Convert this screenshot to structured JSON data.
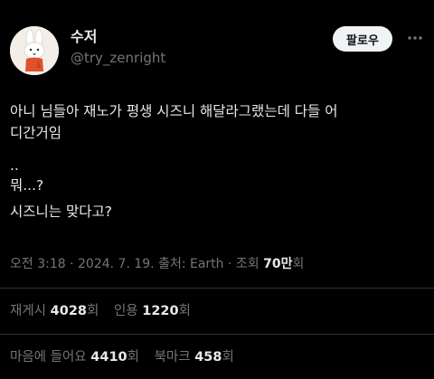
{
  "author": {
    "display_name": "수저",
    "handle": "@try_zenright"
  },
  "follow_button_label": "팔로우",
  "tweet": {
    "lines": [
      "아니 님들아 재노가 평생 시즈니 해달라그랬는데 다들 어",
      "디간거임",
      "..",
      "뭐...?",
      "시즈니는 맞다고?"
    ]
  },
  "meta": {
    "time": "오전 3:18",
    "date": "2024. 7. 19.",
    "source_label": "출처: Earth",
    "views_label": "조회",
    "views_value": "70만",
    "views_unit": "회",
    "separator": "·"
  },
  "stats": {
    "reposts": {
      "label": "재게시",
      "value": "4028",
      "unit": "회"
    },
    "quotes": {
      "label": "인용",
      "value": "1220",
      "unit": "회"
    },
    "likes": {
      "label": "마음에 들어요",
      "value": "4410",
      "unit": "회"
    },
    "bookmarks": {
      "label": "북마크",
      "value": "458",
      "unit": "회"
    }
  },
  "icons": {
    "avatar": "miffy-rabbit-avatar",
    "more": "more-horizontal-icon"
  },
  "colors": {
    "background": "#000000",
    "primary_text": "#e7e9ea",
    "secondary_text": "#71767b",
    "divider": "#2f3336",
    "follow_button_bg": "#eff3f4"
  }
}
